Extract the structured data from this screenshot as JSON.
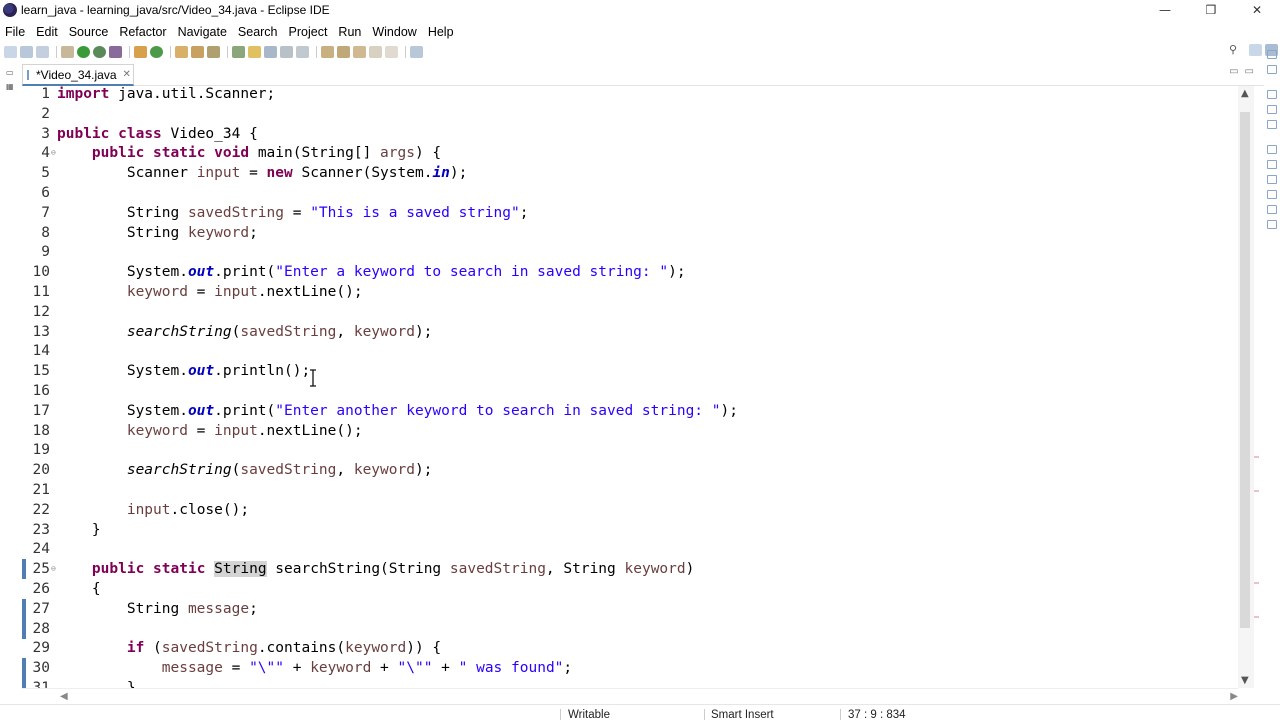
{
  "window": {
    "title": "learn_java - learning_java/src/Video_34.java - Eclipse IDE",
    "controls": [
      "—",
      "❒",
      "✕"
    ]
  },
  "menu": [
    "File",
    "Edit",
    "Source",
    "Refactor",
    "Navigate",
    "Search",
    "Project",
    "Run",
    "Window",
    "Help"
  ],
  "editor_tab": {
    "label": "*Video_34.java",
    "close": "✕"
  },
  "code_lines": [
    {
      "n": "1",
      "text": "import java.util.Scanner;"
    },
    {
      "n": "2",
      "text": ""
    },
    {
      "n": "3",
      "text": "public class Video_34 {"
    },
    {
      "n": "4",
      "text": "    public static void main(String[] args) {"
    },
    {
      "n": "5",
      "text": "        Scanner input = new Scanner(System.in);"
    },
    {
      "n": "6",
      "text": ""
    },
    {
      "n": "7",
      "text": "        String savedString = \"This is a saved string\";"
    },
    {
      "n": "8",
      "text": "        String keyword;"
    },
    {
      "n": "9",
      "text": ""
    },
    {
      "n": "10",
      "text": "        System.out.print(\"Enter a keyword to search in saved string: \");"
    },
    {
      "n": "11",
      "text": "        keyword = input.nextLine();"
    },
    {
      "n": "12",
      "text": ""
    },
    {
      "n": "13",
      "text": "        searchString(savedString, keyword);"
    },
    {
      "n": "14",
      "text": ""
    },
    {
      "n": "15",
      "text": "        System.out.println();"
    },
    {
      "n": "16",
      "text": ""
    },
    {
      "n": "17",
      "text": "        System.out.print(\"Enter another keyword to search in saved string: \");"
    },
    {
      "n": "18",
      "text": "        keyword = input.nextLine();"
    },
    {
      "n": "19",
      "text": ""
    },
    {
      "n": "20",
      "text": "        searchString(savedString, keyword);"
    },
    {
      "n": "21",
      "text": ""
    },
    {
      "n": "22",
      "text": "        input.close();"
    },
    {
      "n": "23",
      "text": "    }"
    },
    {
      "n": "24",
      "text": ""
    },
    {
      "n": "25",
      "text": "    public static String searchString(String savedString, String keyword)"
    },
    {
      "n": "26",
      "text": "    {"
    },
    {
      "n": "27",
      "text": "        String message;"
    },
    {
      "n": "28",
      "text": ""
    },
    {
      "n": "29",
      "text": "        if (savedString.contains(keyword)) {"
    },
    {
      "n": "30",
      "text": "            message = \"\\\"\" + keyword + \"\\\"\" + \" was found\";"
    },
    {
      "n": "31",
      "text": "        }"
    }
  ],
  "status": {
    "writable": "Writable",
    "insert_mode": "Smart Insert",
    "position": "37 : 9 : 834"
  },
  "colors": {
    "keyword": "#7f0055",
    "string": "#2a00ff",
    "local_variable": "#6a3e3e",
    "static_field": "#0000c0",
    "change_marker": "#4f7eb3"
  }
}
